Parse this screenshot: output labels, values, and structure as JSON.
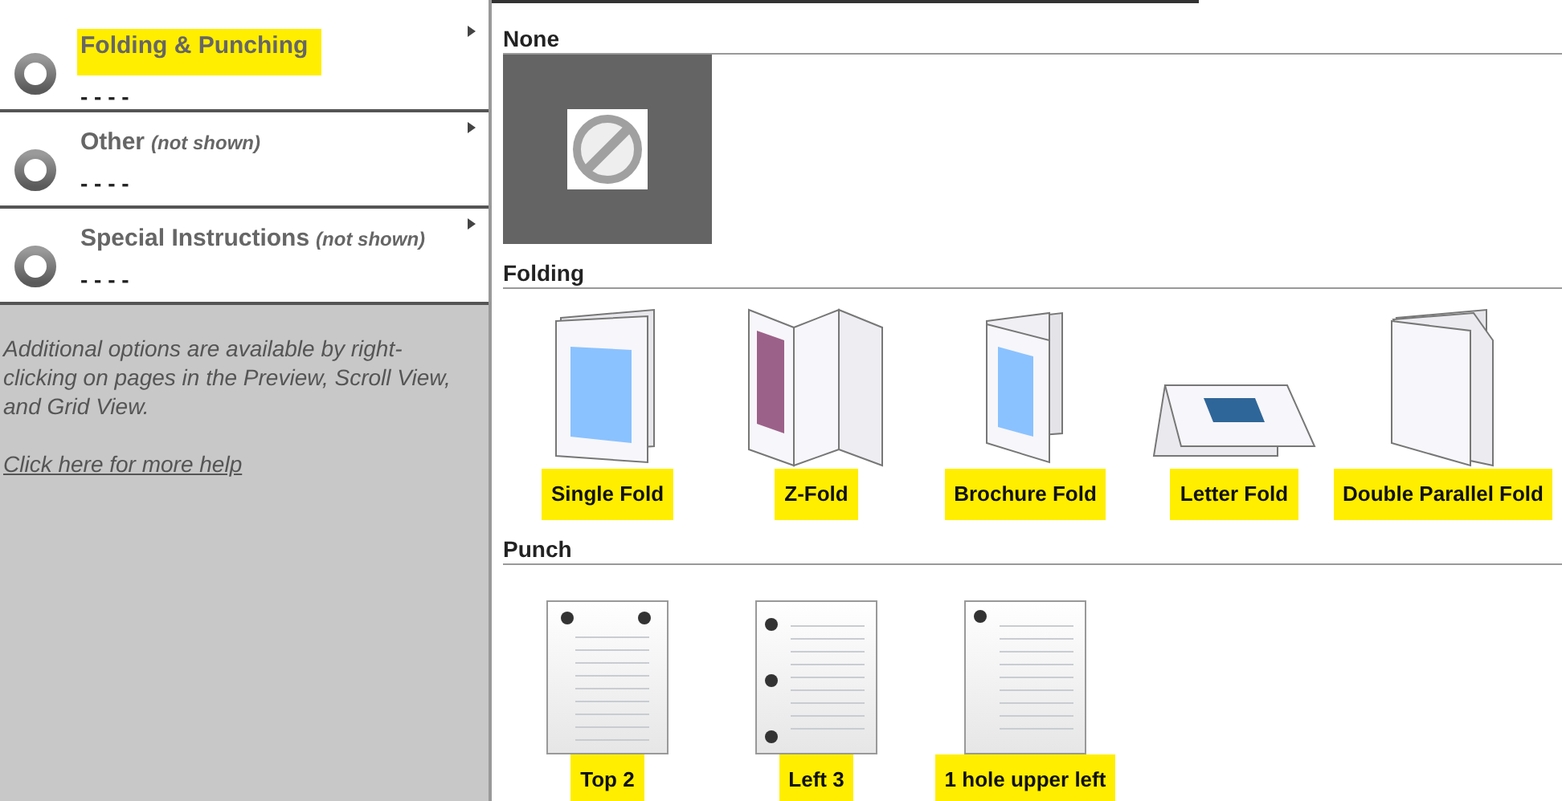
{
  "sidebar": {
    "items": [
      {
        "title": "Folding & Punching",
        "value": "- - - -",
        "highlighted": true
      },
      {
        "title": "Other",
        "note": "(not shown)",
        "value": "- - - -",
        "highlighted": false
      },
      {
        "title": "Special Instructions",
        "note": "(not shown)",
        "value": "- - - -",
        "highlighted": false
      }
    ],
    "help_text": "Additional options are available by right-clicking on pages in the Preview, Scroll View, and Grid View.",
    "help_link": "Click here for more help"
  },
  "sections": [
    {
      "title": "None",
      "options": [
        {
          "kind": "none",
          "selected": true
        }
      ]
    },
    {
      "title": "Folding",
      "options": [
        {
          "kind": "single",
          "label": "Single Fold",
          "selected": false,
          "highlighted": true
        },
        {
          "kind": "z",
          "label": "Z-Fold",
          "selected": false,
          "highlighted": true
        },
        {
          "kind": "brochure",
          "label": "Brochure Fold",
          "selected": false,
          "highlighted": true
        },
        {
          "kind": "letter",
          "label": "Letter Fold",
          "selected": false,
          "highlighted": true
        },
        {
          "kind": "double",
          "label": "Double Parallel Fold",
          "selected": false,
          "highlighted": true
        }
      ]
    },
    {
      "title": "Punch",
      "options": [
        {
          "kind": "top2",
          "label": "Top 2",
          "selected": false,
          "highlighted": true
        },
        {
          "kind": "left3",
          "label": "Left 3",
          "selected": false,
          "highlighted": true
        },
        {
          "kind": "upperleft",
          "label": "1 hole upper left",
          "selected": false,
          "highlighted": true
        }
      ]
    }
  ]
}
